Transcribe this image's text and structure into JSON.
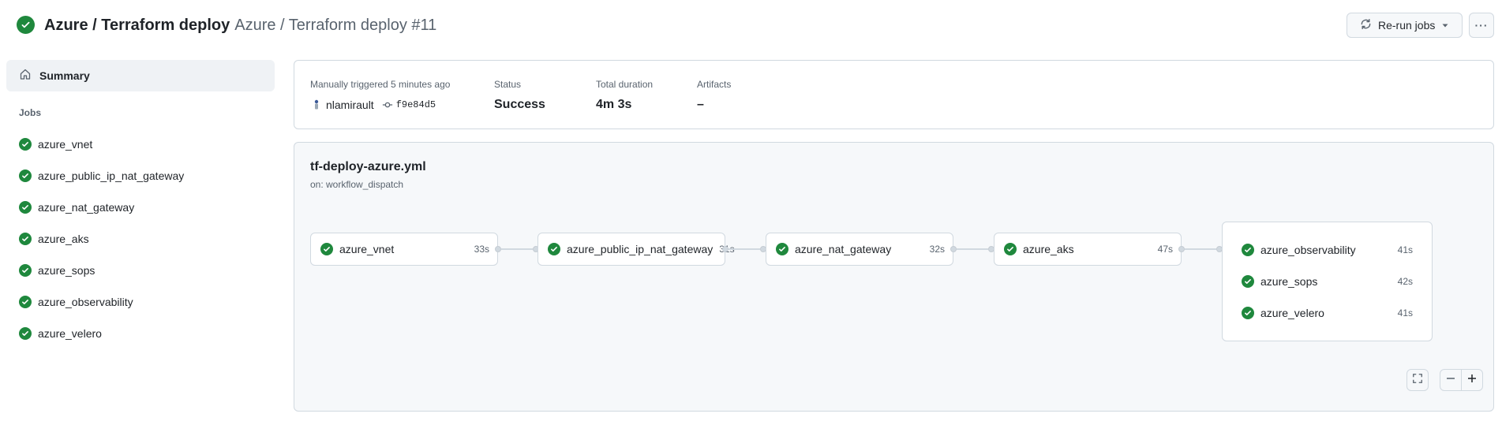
{
  "header": {
    "workflow_name": "Azure / Terraform deploy",
    "run_title": "Azure / Terraform deploy #11",
    "status_icon": "check-circle-fill-icon",
    "rerun_label": "Re-run jobs",
    "more_label": "···",
    "colors": {
      "success": "#1f883d"
    }
  },
  "sidebar": {
    "summary_label": "Summary",
    "jobs_heading": "Jobs",
    "jobs": [
      {
        "name": "azure_vnet"
      },
      {
        "name": "azure_public_ip_nat_gateway"
      },
      {
        "name": "azure_nat_gateway"
      },
      {
        "name": "azure_aks"
      },
      {
        "name": "azure_sops"
      },
      {
        "name": "azure_observability"
      },
      {
        "name": "azure_velero"
      }
    ]
  },
  "summary": {
    "trigger_label": "Manually triggered 5 minutes ago",
    "actor": "nlamirault",
    "commit_sha": "f9e84d5",
    "status_label": "Status",
    "status_value": "Success",
    "duration_label": "Total duration",
    "duration_value": "4m 3s",
    "artifacts_label": "Artifacts",
    "artifacts_value": "–"
  },
  "graph": {
    "file": "tf-deploy-azure.yml",
    "trigger": "on: workflow_dispatch",
    "nodes": [
      {
        "name": "azure_vnet",
        "duration": "33s"
      },
      {
        "name": "azure_public_ip_nat_gateway",
        "duration": "31s"
      },
      {
        "name": "azure_nat_gateway",
        "duration": "32s"
      },
      {
        "name": "azure_aks",
        "duration": "47s"
      }
    ],
    "group": [
      {
        "name": "azure_observability",
        "duration": "41s"
      },
      {
        "name": "azure_sops",
        "duration": "42s"
      },
      {
        "name": "azure_velero",
        "duration": "41s"
      }
    ]
  }
}
